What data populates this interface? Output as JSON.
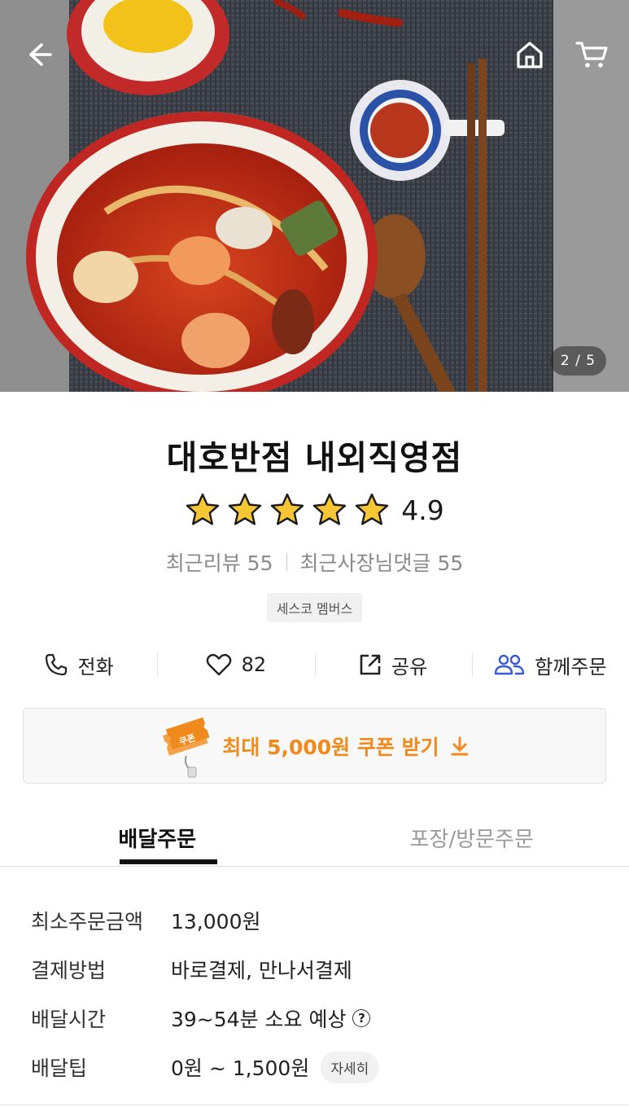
{
  "hero": {
    "image_counter": "2 / 5",
    "icons": [
      "back-arrow-icon",
      "home-icon",
      "cart-icon"
    ]
  },
  "store": {
    "name": "대호반점 내외직영점",
    "rating": "4.9",
    "stars": 5,
    "recent_reviews": "최근리뷰 55",
    "owner_replies": "최근사장님댓글 55",
    "badge": "세스코 멤버스"
  },
  "actions": {
    "call": "전화",
    "likes": "82",
    "share": "공유",
    "group_order": "함께주문"
  },
  "coupon": {
    "ticket_label": "쿠폰",
    "text": "최대 5,000원 쿠폰 받기",
    "color": "#f08a1c"
  },
  "tabs": {
    "delivery": "배달주문",
    "pickup": "포장/방문주문",
    "active": "delivery"
  },
  "info": {
    "min_order_label": "최소주문금액",
    "min_order_value": "13,000원",
    "payment_label": "결제방법",
    "payment_value": "바로결제, 만나서결제",
    "delivery_time_label": "배달시간",
    "delivery_time_value": "39~54분 소요 예상",
    "help_mark": "?",
    "delivery_tip_label": "배달팁",
    "delivery_tip_value": "0원 ~ 1,500원",
    "detail_button": "자세히"
  }
}
